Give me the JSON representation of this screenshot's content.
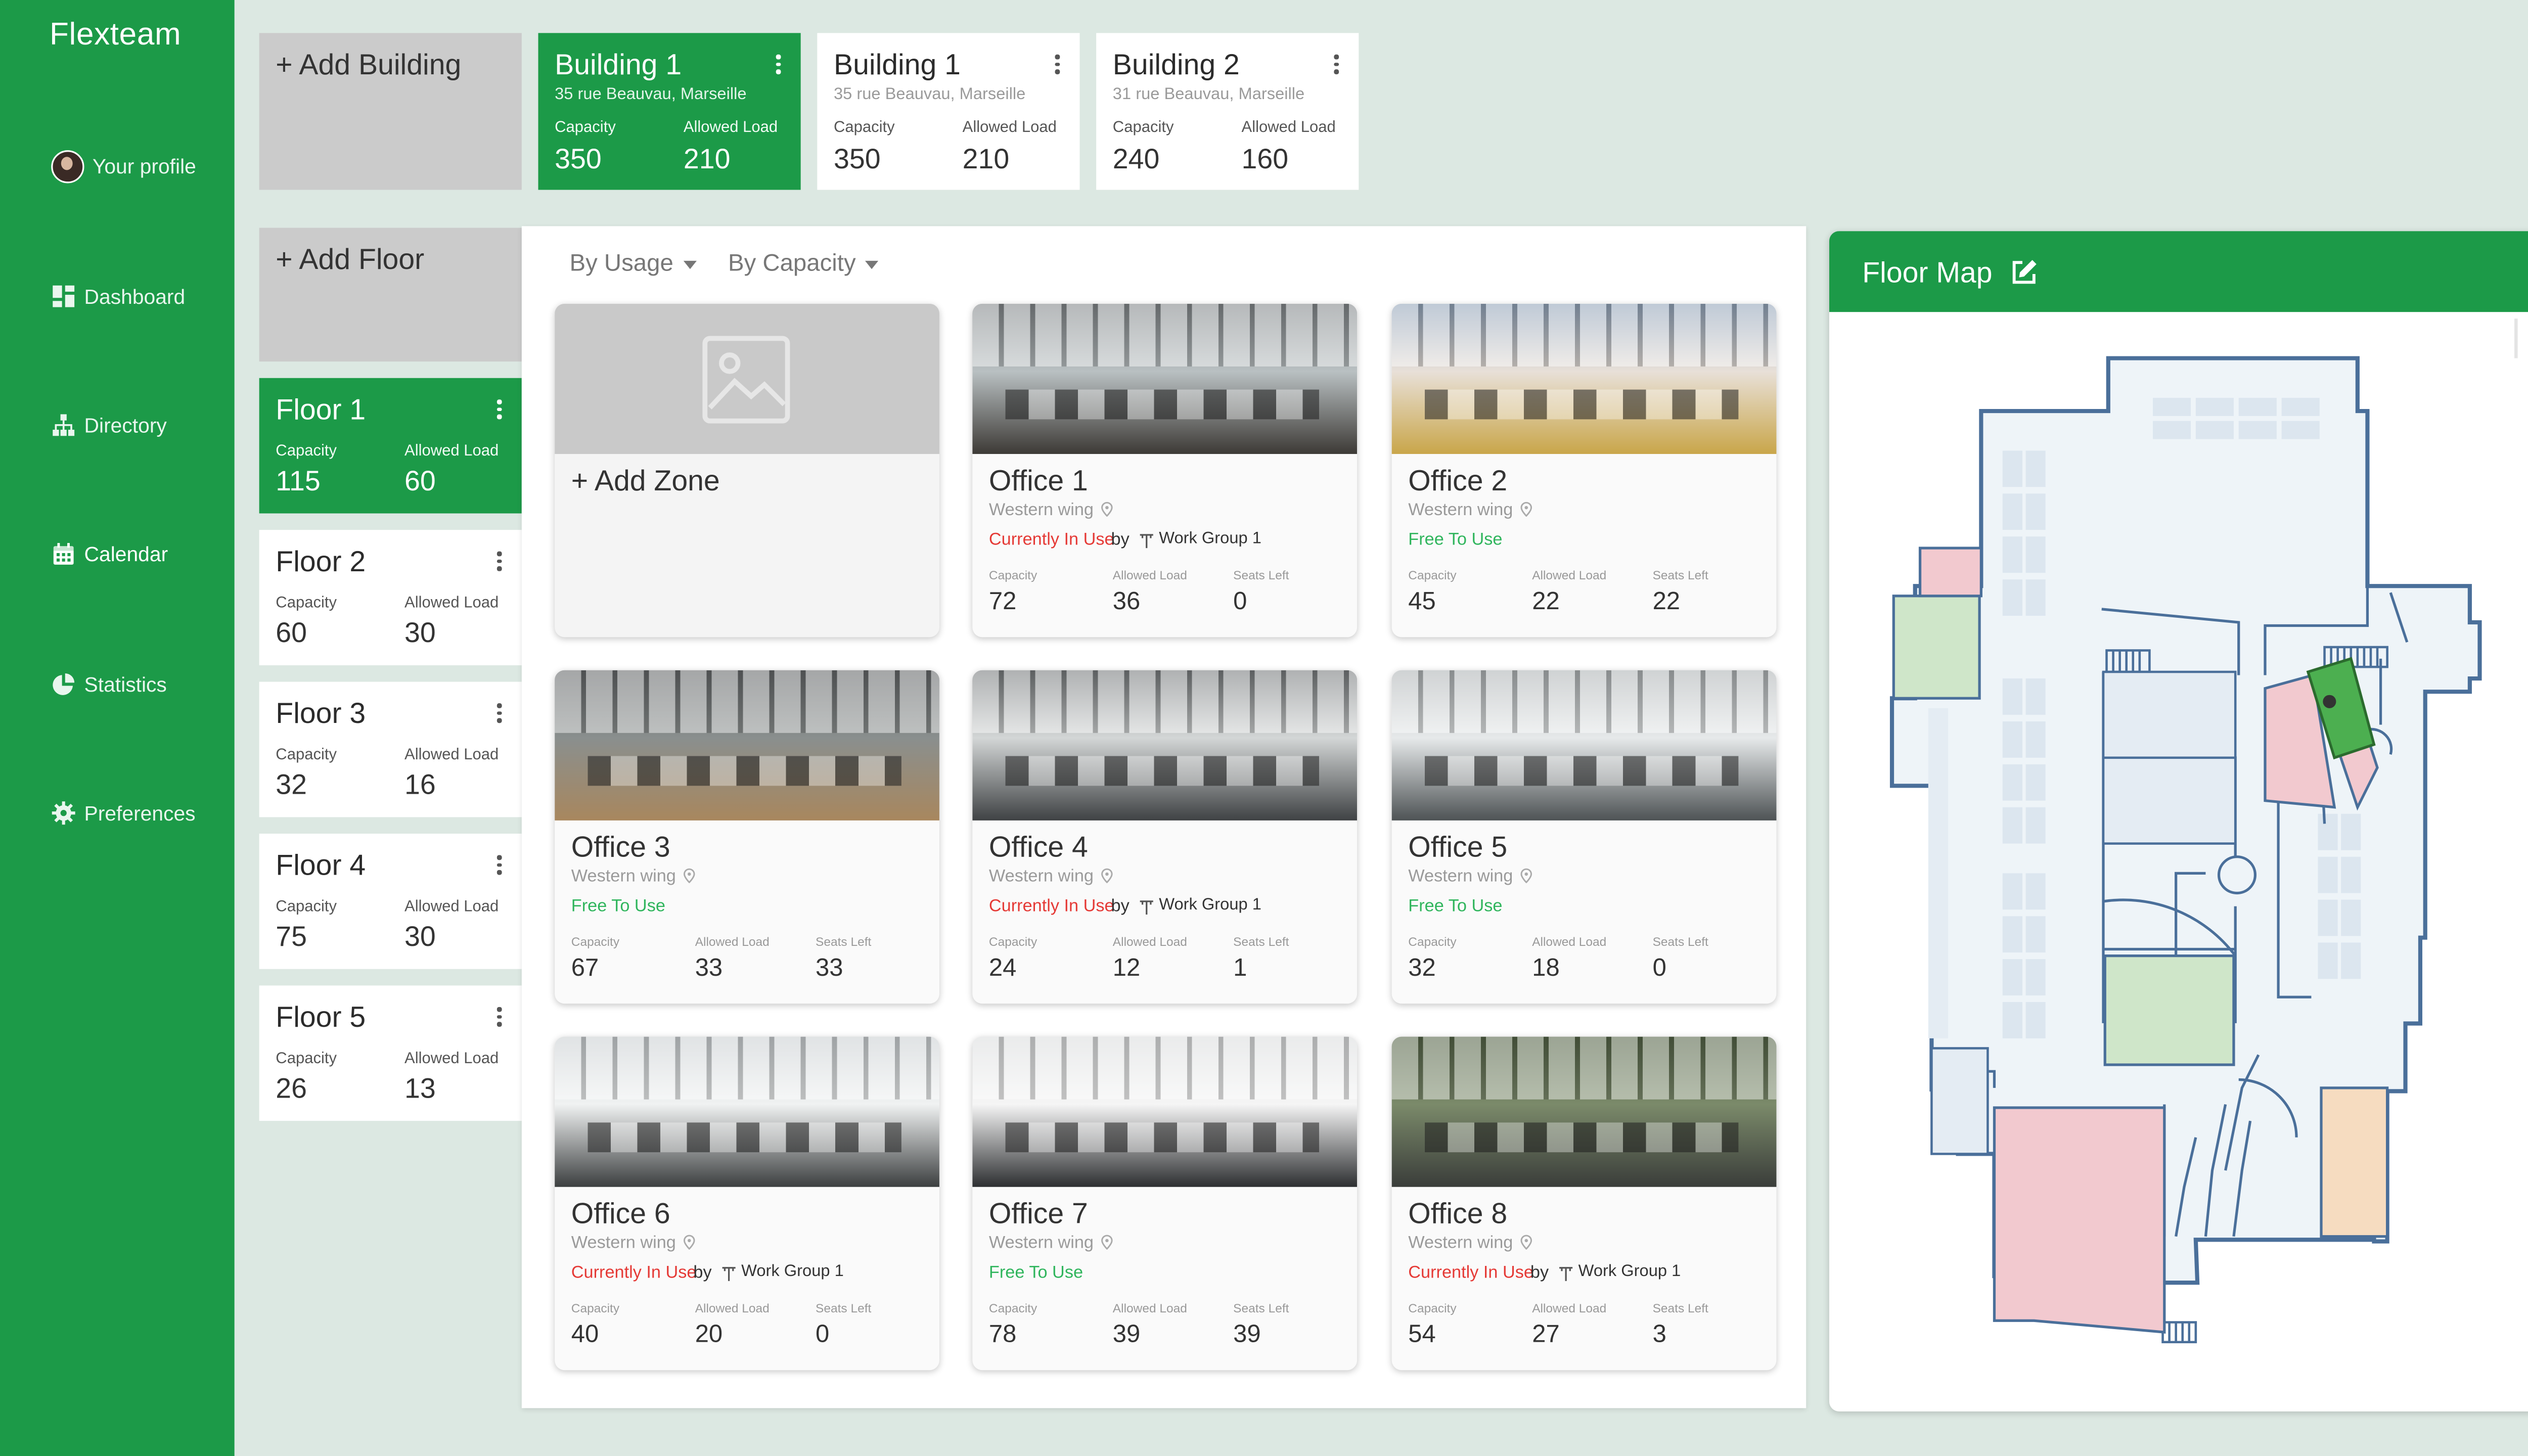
{
  "app": {
    "brand": "Flexteam"
  },
  "nav": {
    "profile": "Your profile",
    "dashboard": "Dashboard",
    "directory": "Directory",
    "calendar": "Calendar",
    "statistics": "Statistics",
    "preferences": "Preferences"
  },
  "labels": {
    "capacity": "Capacity",
    "allowed_load": "Allowed Load",
    "seats_left": "Seats Left",
    "by": "by"
  },
  "buildings": {
    "add_label": "+ Add Building",
    "items": [
      {
        "name": "Building 1",
        "address": "35 rue Beauvau, Marseille",
        "capacity": "350",
        "allowed_load": "210",
        "selected": true
      },
      {
        "name": "Building 1",
        "address": "35 rue Beauvau, Marseille",
        "capacity": "350",
        "allowed_load": "210",
        "selected": false
      },
      {
        "name": "Building 2",
        "address": "31 rue Beauvau, Marseille",
        "capacity": "240",
        "allowed_load": "160",
        "selected": false
      }
    ]
  },
  "floors": {
    "add_label": "+ Add Floor",
    "items": [
      {
        "name": "Floor 1",
        "capacity": "115",
        "allowed_load": "60",
        "selected": true
      },
      {
        "name": "Floor 2",
        "capacity": "60",
        "allowed_load": "30",
        "selected": false
      },
      {
        "name": "Floor 3",
        "capacity": "32",
        "allowed_load": "16",
        "selected": false
      },
      {
        "name": "Floor 4",
        "capacity": "75",
        "allowed_load": "30",
        "selected": false
      },
      {
        "name": "Floor 5",
        "capacity": "26",
        "allowed_load": "13",
        "selected": false
      }
    ]
  },
  "filters": {
    "by_usage": "By Usage",
    "by_capacity": "By Capacity"
  },
  "zones": {
    "add_label": "+ Add Zone",
    "items": [
      {
        "name": "Office 1",
        "wing": "Western wing",
        "status": "Currently In Use",
        "in_use": true,
        "group": "Work Group 1",
        "capacity": "72",
        "allowed_load": "36",
        "seats_left": "0"
      },
      {
        "name": "Office 2",
        "wing": "Western wing",
        "status": "Free To Use",
        "in_use": false,
        "group": "",
        "capacity": "45",
        "allowed_load": "22",
        "seats_left": "22"
      },
      {
        "name": "Office 3",
        "wing": "Western wing",
        "status": "Free To Use",
        "in_use": false,
        "group": "",
        "capacity": "67",
        "allowed_load": "33",
        "seats_left": "33"
      },
      {
        "name": "Office 4",
        "wing": "Western wing",
        "status": "Currently In Use",
        "in_use": true,
        "group": "Work Group 1",
        "capacity": "24",
        "allowed_load": "12",
        "seats_left": "1"
      },
      {
        "name": "Office 5",
        "wing": "Western wing",
        "status": "Free To Use",
        "in_use": false,
        "group": "",
        "capacity": "32",
        "allowed_load": "18",
        "seats_left": "0"
      },
      {
        "name": "Office 6",
        "wing": "Western wing",
        "status": "Currently In Use",
        "in_use": true,
        "group": "Work Group 1",
        "capacity": "40",
        "allowed_load": "20",
        "seats_left": "0"
      },
      {
        "name": "Office 7",
        "wing": "Western wing",
        "status": "Free To Use",
        "in_use": false,
        "group": "",
        "capacity": "78",
        "allowed_load": "39",
        "seats_left": "39"
      },
      {
        "name": "Office 8",
        "wing": "Western wing",
        "status": "Currently In Use",
        "in_use": true,
        "group": "Work Group 1",
        "capacity": "54",
        "allowed_load": "27",
        "seats_left": "3"
      }
    ]
  },
  "floor_map": {
    "title": "Floor Map"
  },
  "colors": {
    "brand_green": "#1c9a48",
    "in_use_red": "#e53935",
    "free_green": "#2fb55c",
    "map_wall": "#4a6f9a",
    "map_floor": "#eef4f8",
    "zone_red": "#f2c9cf",
    "zone_green": "#cfe6c9",
    "zone_orange": "#f6dcc0"
  }
}
